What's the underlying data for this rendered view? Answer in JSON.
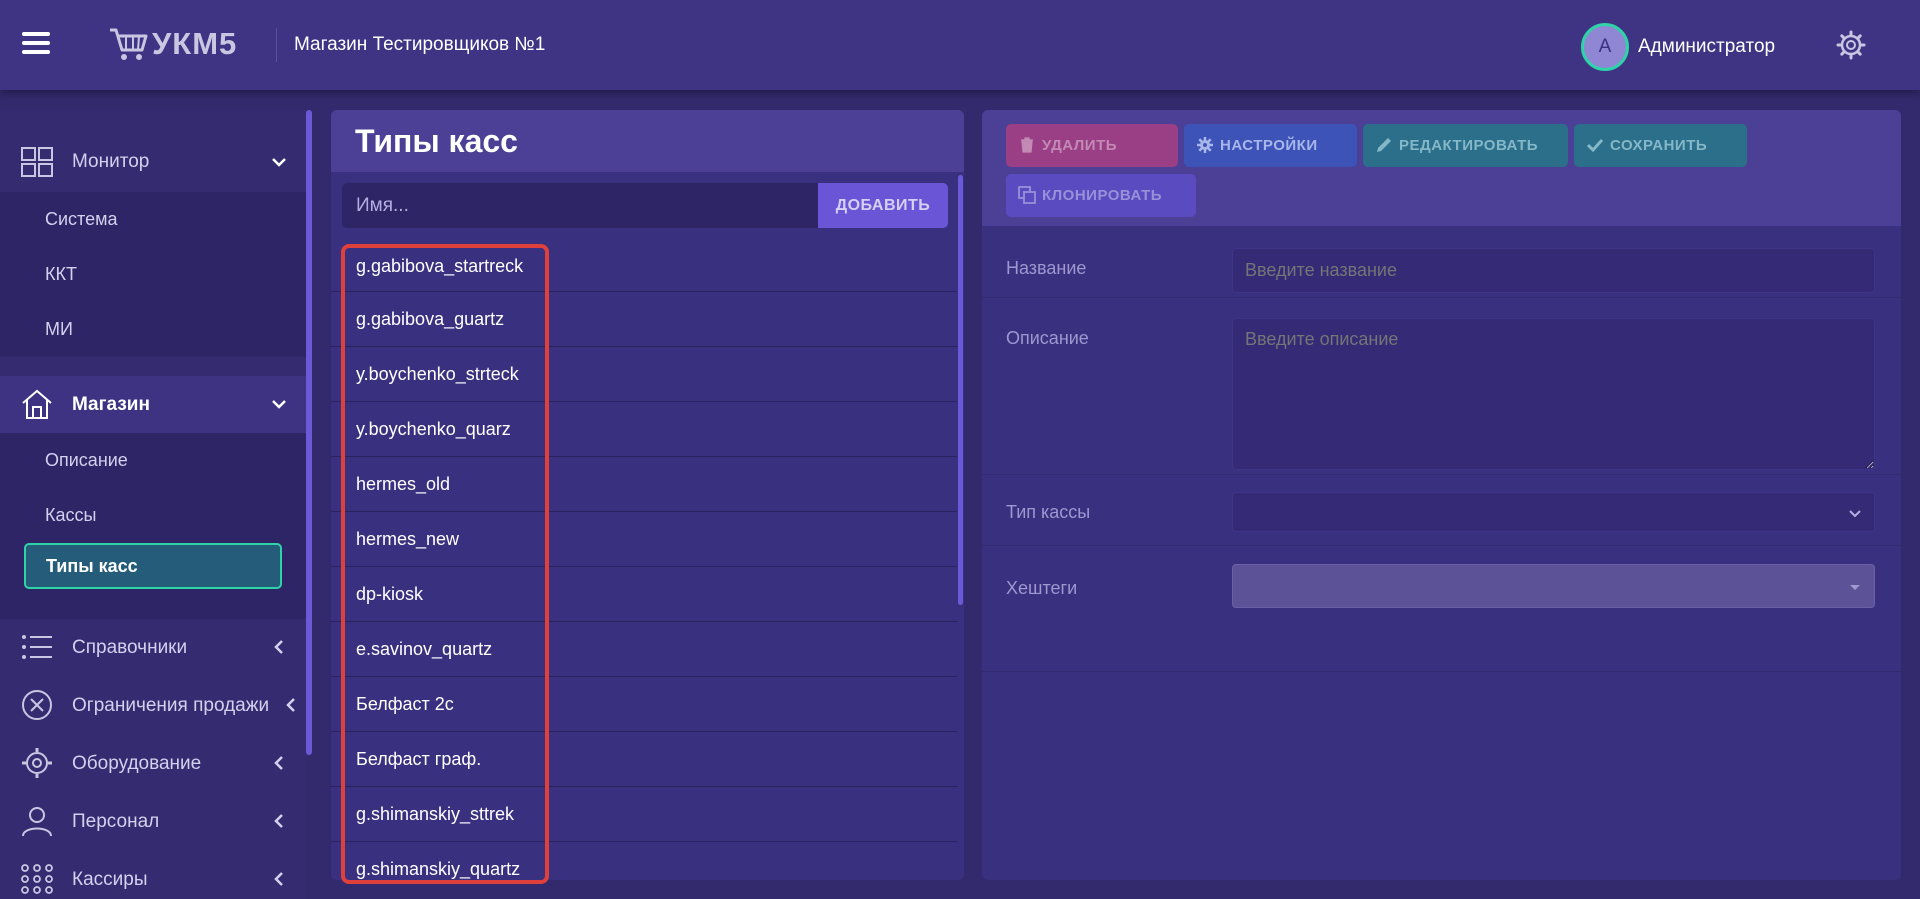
{
  "header": {
    "logo_text": "УКМ5",
    "store_title": "Магазин Тестировщиков №1",
    "avatar_letter": "А",
    "user_name": "Администратор"
  },
  "sidebar": {
    "monitor": {
      "label": "Монитор",
      "items": [
        "Система",
        "ККТ",
        "МИ"
      ]
    },
    "store": {
      "label": "Магазин",
      "items": [
        "Описание",
        "Кассы",
        "Типы касс"
      ],
      "selected": "Типы касс"
    },
    "sections": [
      {
        "label": "Справочники",
        "icon": "list-icon"
      },
      {
        "label": "Ограничения продажи",
        "icon": "circle-x-icon"
      },
      {
        "label": "Оборудование",
        "icon": "gear-icon"
      },
      {
        "label": "Персонал",
        "icon": "person-icon"
      },
      {
        "label": "Кассиры",
        "icon": "dots-grid-icon"
      }
    ]
  },
  "middle": {
    "title": "Типы касс",
    "name_placeholder": "Имя...",
    "add_label": "ДОБАВИТЬ",
    "items": [
      "g.gabibova_startreck",
      "g.gabibova_guartz",
      "y.boychenko_strteck",
      "y.boychenko_quarz",
      "hermes_old",
      "hermes_new",
      "dp-kiosk",
      "e.savinov_quartz",
      "Белфаст 2с",
      "Белфаст граф.",
      "g.shimanskiy_sttrek",
      "g.shimanskiy_quartz"
    ]
  },
  "toolbar": {
    "delete_label": "УДАЛИТЬ",
    "settings_label": "НАСТРОЙКИ",
    "edit_label": "РЕДАКТИРОВАТЬ",
    "save_label": "СОХРАНИТЬ",
    "clone_label": "КЛОНИРОВАТЬ"
  },
  "form": {
    "name_label": "Название",
    "name_placeholder": "Введите название",
    "description_label": "Описание",
    "description_placeholder": "Введите описание",
    "type_label": "Тип кассы",
    "tags_label": "Хештеги"
  },
  "colors": {
    "accent_teal": "#2ed3a8",
    "highlight_red": "#e0403a",
    "background": "#332a6e"
  }
}
